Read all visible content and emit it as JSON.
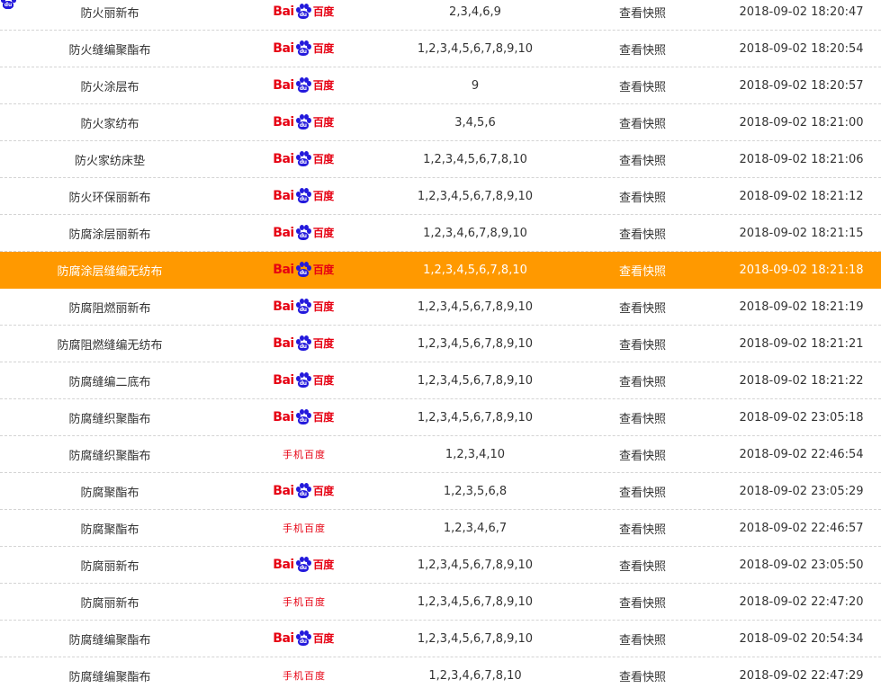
{
  "colors": {
    "highlight_bg": "#ff9900",
    "baidu_red": "#e60012",
    "baidu_blue": "#2319dc",
    "row_divider": "#d4d4d4"
  },
  "logos": {
    "pc": {
      "prefix": "Bai",
      "paw_text": "du",
      "suffix": "百度"
    },
    "mobile": {
      "paw_text": "du",
      "text": "手机百度"
    }
  },
  "rows": [
    {
      "keyword": "防火丽新布",
      "engine": "pc",
      "ranks": "2,3,4,6,9",
      "snapshot": "查看快照",
      "time": "2018-09-02 18:20:47"
    },
    {
      "keyword": "防火缝编聚酯布",
      "engine": "pc",
      "ranks": "1,2,3,4,5,6,7,8,9,10",
      "snapshot": "查看快照",
      "time": "2018-09-02 18:20:54"
    },
    {
      "keyword": "防火涂层布",
      "engine": "pc",
      "ranks": "9",
      "snapshot": "查看快照",
      "time": "2018-09-02 18:20:57"
    },
    {
      "keyword": "防火家纺布",
      "engine": "pc",
      "ranks": "3,4,5,6",
      "snapshot": "查看快照",
      "time": "2018-09-02 18:21:00"
    },
    {
      "keyword": "防火家纺床垫",
      "engine": "pc",
      "ranks": "1,2,3,4,5,6,7,8,10",
      "snapshot": "查看快照",
      "time": "2018-09-02 18:21:06"
    },
    {
      "keyword": "防火环保丽新布",
      "engine": "pc",
      "ranks": "1,2,3,4,5,6,7,8,9,10",
      "snapshot": "查看快照",
      "time": "2018-09-02 18:21:12"
    },
    {
      "keyword": "防腐涂层丽新布",
      "engine": "pc",
      "ranks": "1,2,3,4,6,7,8,9,10",
      "snapshot": "查看快照",
      "time": "2018-09-02 18:21:15"
    },
    {
      "keyword": "防腐涂层缝编无纺布",
      "engine": "pc",
      "ranks": "1,2,3,4,5,6,7,8,10",
      "snapshot": "查看快照",
      "time": "2018-09-02 18:21:18",
      "highlight": true
    },
    {
      "keyword": "防腐阻燃丽新布",
      "engine": "pc",
      "ranks": "1,2,3,4,5,6,7,8,9,10",
      "snapshot": "查看快照",
      "time": "2018-09-02 18:21:19"
    },
    {
      "keyword": "防腐阻燃缝编无纺布",
      "engine": "pc",
      "ranks": "1,2,3,4,5,6,7,8,9,10",
      "snapshot": "查看快照",
      "time": "2018-09-02 18:21:21"
    },
    {
      "keyword": "防腐缝编二底布",
      "engine": "pc",
      "ranks": "1,2,3,4,5,6,7,8,9,10",
      "snapshot": "查看快照",
      "time": "2018-09-02 18:21:22"
    },
    {
      "keyword": "防腐缝织聚酯布",
      "engine": "pc",
      "ranks": "1,2,3,4,5,6,7,8,9,10",
      "snapshot": "查看快照",
      "time": "2018-09-02 23:05:18"
    },
    {
      "keyword": "防腐缝织聚酯布",
      "engine": "mobile",
      "ranks": "1,2,3,4,10",
      "snapshot": "查看快照",
      "time": "2018-09-02 22:46:54"
    },
    {
      "keyword": "防腐聚酯布",
      "engine": "pc",
      "ranks": "1,2,3,5,6,8",
      "snapshot": "查看快照",
      "time": "2018-09-02 23:05:29"
    },
    {
      "keyword": "防腐聚酯布",
      "engine": "mobile",
      "ranks": "1,2,3,4,6,7",
      "snapshot": "查看快照",
      "time": "2018-09-02 22:46:57"
    },
    {
      "keyword": "防腐丽新布",
      "engine": "pc",
      "ranks": "1,2,3,4,5,6,7,8,9,10",
      "snapshot": "查看快照",
      "time": "2018-09-02 23:05:50"
    },
    {
      "keyword": "防腐丽新布",
      "engine": "mobile",
      "ranks": "1,2,3,4,5,6,7,8,9,10",
      "snapshot": "查看快照",
      "time": "2018-09-02 22:47:20"
    },
    {
      "keyword": "防腐缝编聚酯布",
      "engine": "pc",
      "ranks": "1,2,3,4,5,6,7,8,9,10",
      "snapshot": "查看快照",
      "time": "2018-09-02 20:54:34"
    },
    {
      "keyword": "防腐缝编聚酯布",
      "engine": "mobile",
      "ranks": "1,2,3,4,6,7,8,10",
      "snapshot": "查看快照",
      "time": "2018-09-02 22:47:29"
    }
  ]
}
